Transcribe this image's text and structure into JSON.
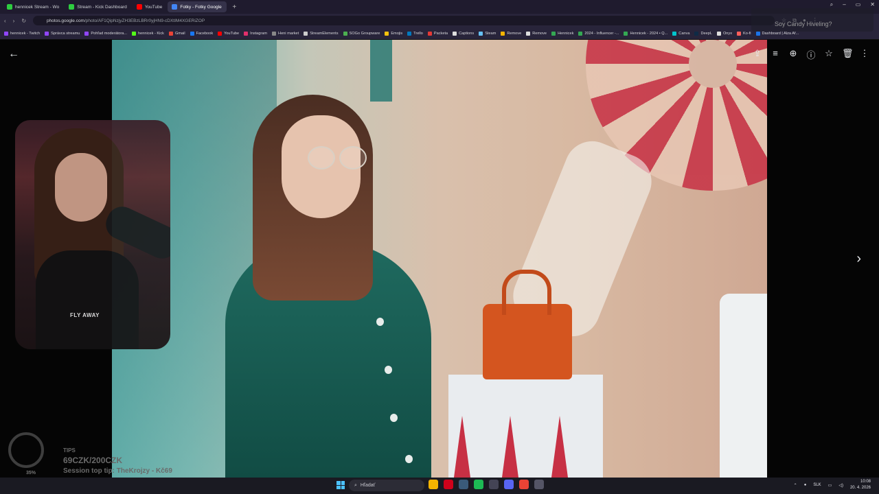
{
  "browser": {
    "tabs": [
      {
        "label": "hennicek Stream - Wo",
        "color": "#2ecc40"
      },
      {
        "label": "Stream - Kick Dashboard",
        "color": "#2ecc40"
      },
      {
        "label": "YouTube",
        "color": "#ff0000"
      },
      {
        "label": "Fotky - Fotky Google",
        "color": "#4285f4",
        "active": true
      }
    ],
    "new_tab_label": "+",
    "window_controls": {
      "search": "⌕",
      "minimize": "–",
      "maximize": "▭",
      "close": "✕"
    },
    "address_host": "photos.google.com",
    "address_path": "/photo/AF1QipNzjyZH3EBzLBRr0yjHN9-cDXtIM4XGERiZOP",
    "bookmarks": [
      {
        "label": "hennicek - Twitch",
        "color": "#9146ff"
      },
      {
        "label": "Správca streamu",
        "color": "#9146ff"
      },
      {
        "label": "Pohľad moderátora...",
        "color": "#9146ff"
      },
      {
        "label": "hennicek - Kick",
        "color": "#53fc18"
      },
      {
        "label": "Gmail",
        "color": "#ea4335"
      },
      {
        "label": "Facebook",
        "color": "#1877f2"
      },
      {
        "label": "YouTube",
        "color": "#ff0000"
      },
      {
        "label": "Instagram",
        "color": "#e1306c"
      },
      {
        "label": "Heni market",
        "color": "#888888"
      },
      {
        "label": "StreamElements",
        "color": "#cccccc"
      },
      {
        "label": "SOGo Groupware",
        "color": "#4caf50"
      },
      {
        "label": "Emojis",
        "color": "#f4c20d"
      },
      {
        "label": "Trello",
        "color": "#0079bf"
      },
      {
        "label": "Packeta",
        "color": "#e53935"
      },
      {
        "label": "Captions",
        "color": "#dddddd"
      },
      {
        "label": "Steam",
        "color": "#66c0f4"
      },
      {
        "label": "Remove",
        "color": "#f4b400"
      },
      {
        "label": "Remove",
        "color": "#dddddd"
      },
      {
        "label": "Hennicek",
        "color": "#34a853"
      },
      {
        "label": "2024 - Influencer -...",
        "color": "#34a853"
      },
      {
        "label": "Hennicek - 2024 • Q...",
        "color": "#34a853"
      },
      {
        "label": "Canva",
        "color": "#00c4cc"
      },
      {
        "label": "DeepL",
        "color": "#0f2b46"
      },
      {
        "label": "Onyx",
        "color": "#dddddd"
      },
      {
        "label": "Ko-fi",
        "color": "#ff5e5b"
      },
      {
        "label": "Dashboard | Alza Af...",
        "color": "#1a73e8"
      }
    ]
  },
  "viewer": {
    "back_icon": "←",
    "toolbar_icons": [
      {
        "name": "share-icon",
        "glyph": "⇪"
      },
      {
        "name": "edit-icon",
        "glyph": "≡"
      },
      {
        "name": "zoom-icon",
        "glyph": "⊕"
      },
      {
        "name": "info-icon",
        "glyph": "ⓘ"
      },
      {
        "name": "star-icon",
        "glyph": "☆"
      },
      {
        "name": "trash-icon",
        "glyph": "🗑"
      },
      {
        "name": "more-icon",
        "glyph": "⋮"
      }
    ],
    "next_icon": "›"
  },
  "overlay": {
    "shirt_text": "FLY AWAY",
    "tips_label": "TIPS",
    "tips_goal": "69CZK/200CZK",
    "tips_top": "Session top tip: TheKrojzy - Kč69",
    "tips_percent": "35%",
    "alert_text": "Soy Candy Hiveling?"
  },
  "taskbar": {
    "search_placeholder": "Hľadať",
    "apps": [
      {
        "name": "file-explorer-icon",
        "color": "#f4b400"
      },
      {
        "name": "opera-icon",
        "color": "#d0021b"
      },
      {
        "name": "steam-icon",
        "color": "#3a5a7a"
      },
      {
        "name": "spotify-icon",
        "color": "#1db954"
      },
      {
        "name": "obs-icon",
        "color": "#444455"
      },
      {
        "name": "discord-icon",
        "color": "#5865f2"
      },
      {
        "name": "chrome-icon",
        "color": "#ea4335"
      },
      {
        "name": "calculator-icon",
        "color": "#555566"
      }
    ],
    "lang": "SLK",
    "time": "10:08",
    "date": "20. 4. 2026"
  }
}
